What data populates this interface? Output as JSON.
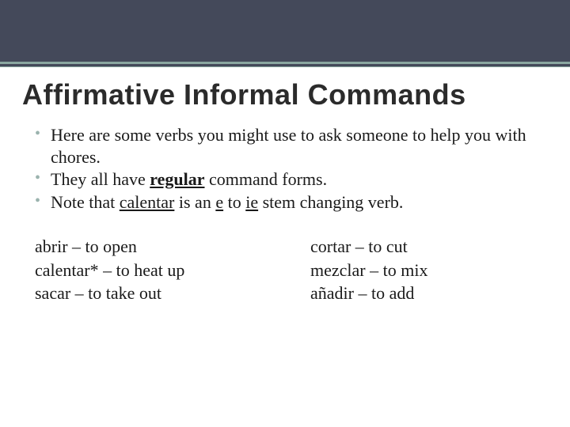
{
  "title": "Affirmative Informal Commands",
  "bullets": {
    "b1_a": "Here are some verbs you might use to ask someone to help you with chores.",
    "b2_a": "They all have ",
    "b2_b": "regular",
    "b2_c": " command forms.",
    "b3_a": "Note that ",
    "b3_b": "calentar",
    "b3_c": " is an ",
    "b3_d": "e",
    "b3_e": " to ",
    "b3_f": "ie",
    "b3_g": " stem changing verb."
  },
  "col1": {
    "r1": "abrir – to open",
    "r2": "calentar* – to heat up",
    "r3": "sacar – to take out"
  },
  "col2": {
    "r1": "cortar – to cut",
    "r2": "mezclar – to mix",
    "r3": "añadir – to add"
  }
}
